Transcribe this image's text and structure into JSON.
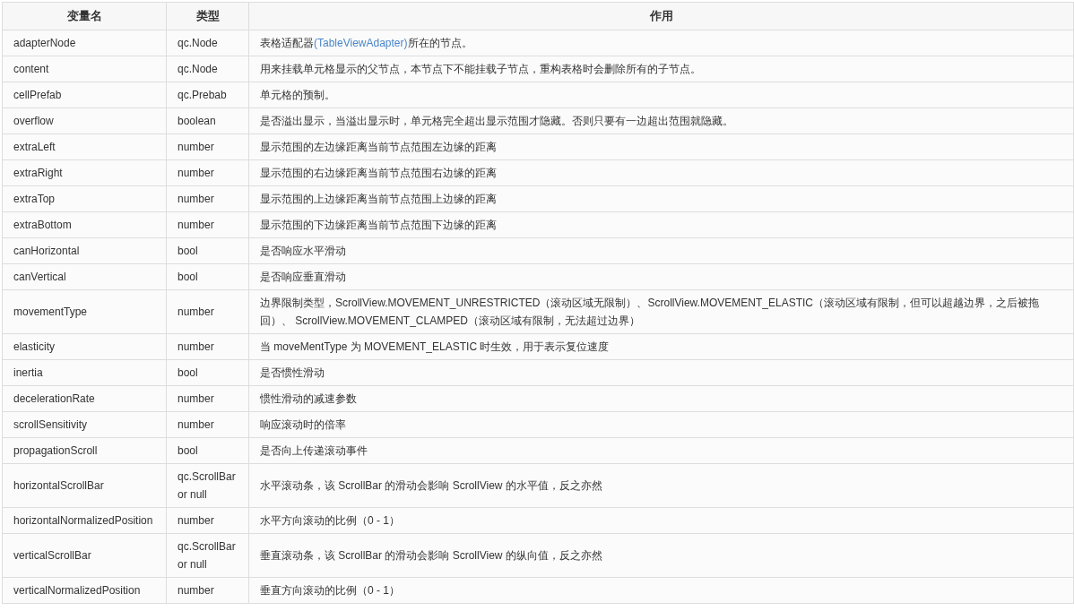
{
  "table": {
    "columns": [
      "变量名",
      "类型",
      "作用"
    ],
    "rows": [
      {
        "name": "adapterNode",
        "type": "qc.Node",
        "desc": [
          {
            "kind": "text",
            "text": "表格适配器"
          },
          {
            "kind": "link",
            "text": "(TableViewAdapter)"
          },
          {
            "kind": "text",
            "text": "所在的节点。"
          }
        ]
      },
      {
        "name": "content",
        "type": "qc.Node",
        "desc": [
          {
            "kind": "text",
            "text": "用来挂载单元格显示的父节点，本节点下不能挂载子节点，重构表格时会删除所有的子节点。"
          }
        ]
      },
      {
        "name": "cellPrefab",
        "type": "qc.Prebab",
        "desc": [
          {
            "kind": "text",
            "text": "单元格的预制。"
          }
        ]
      },
      {
        "name": "overflow",
        "type": "boolean",
        "desc": [
          {
            "kind": "text",
            "text": "是否溢出显示，当溢出显示时，单元格完全超出显示范围才隐藏。否则只要有一边超出范围就隐藏。"
          }
        ]
      },
      {
        "name": "extraLeft",
        "type": "number",
        "desc": [
          {
            "kind": "text",
            "text": "显示范围的左边缘距离当前节点范围左边缘的距离"
          }
        ]
      },
      {
        "name": "extraRight",
        "type": "number",
        "desc": [
          {
            "kind": "text",
            "text": "显示范围的右边缘距离当前节点范围右边缘的距离"
          }
        ]
      },
      {
        "name": "extraTop",
        "type": "number",
        "desc": [
          {
            "kind": "text",
            "text": "显示范围的上边缘距离当前节点范围上边缘的距离"
          }
        ]
      },
      {
        "name": "extraBottom",
        "type": "number",
        "desc": [
          {
            "kind": "text",
            "text": "显示范围的下边缘距离当前节点范围下边缘的距离"
          }
        ]
      },
      {
        "name": "canHorizontal",
        "type": "bool",
        "desc": [
          {
            "kind": "text",
            "text": "是否响应水平滑动"
          }
        ]
      },
      {
        "name": "canVertical",
        "type": "bool",
        "desc": [
          {
            "kind": "text",
            "text": "是否响应垂直滑动"
          }
        ]
      },
      {
        "name": "movementType",
        "type": "number",
        "desc": [
          {
            "kind": "text",
            "text": "边界限制类型，ScrollView.MOVEMENT_UNRESTRICTED（滚动区域无限制）、ScrollView.MOVEMENT_ELASTIC（滚动区域有限制，但可以超越边界，之后被拖回）、 ScrollView.MOVEMENT_CLAMPED（滚动区域有限制，无法超过边界）"
          }
        ]
      },
      {
        "name": "elasticity",
        "type": "number",
        "desc": [
          {
            "kind": "text",
            "text": "当 moveMentType 为 MOVEMENT_ELASTIC 时生效，用于表示复位速度"
          }
        ]
      },
      {
        "name": "inertia",
        "type": "bool",
        "desc": [
          {
            "kind": "text",
            "text": "是否惯性滑动"
          }
        ]
      },
      {
        "name": "decelerationRate",
        "type": "number",
        "desc": [
          {
            "kind": "text",
            "text": "惯性滑动的减速参数"
          }
        ]
      },
      {
        "name": "scrollSensitivity",
        "type": "number",
        "desc": [
          {
            "kind": "text",
            "text": "响应滚动时的倍率"
          }
        ]
      },
      {
        "name": "propagationScroll",
        "type": "bool",
        "desc": [
          {
            "kind": "text",
            "text": "是否向上传递滚动事件"
          }
        ]
      },
      {
        "name": "horizontalScrollBar",
        "type": "qc.ScrollBar or null",
        "desc": [
          {
            "kind": "text",
            "text": "水平滚动条，该 ScrollBar 的滑动会影响 ScrollView 的水平值，反之亦然"
          }
        ]
      },
      {
        "name": "horizontalNormalizedPosition",
        "type": "number",
        "desc": [
          {
            "kind": "text",
            "text": "水平方向滚动的比例（0 - 1）"
          }
        ]
      },
      {
        "name": "verticalScrollBar",
        "type": "qc.ScrollBar or null",
        "desc": [
          {
            "kind": "text",
            "text": "垂直滚动条，该 ScrollBar 的滑动会影响 ScrollView 的纵向值，反之亦然"
          }
        ]
      },
      {
        "name": "verticalNormalizedPosition",
        "type": "number",
        "desc": [
          {
            "kind": "text",
            "text": "垂直方向滚动的比例（0 - 1）"
          }
        ]
      }
    ]
  }
}
